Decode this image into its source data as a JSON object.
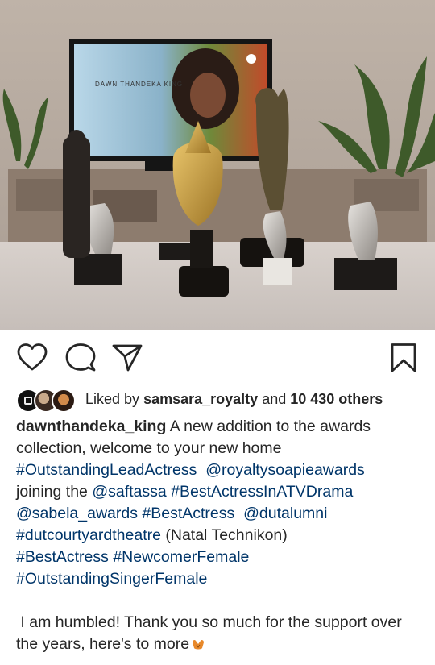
{
  "photo": {
    "tv_overlay_text": "DAWN THANDEKA KING",
    "alt": "awards trophies in front of television"
  },
  "actions": {
    "like_icon": "heart-icon",
    "comment_icon": "comment-icon",
    "share_icon": "send-icon",
    "save_icon": "bookmark-icon"
  },
  "likes": {
    "prefix": "Liked by",
    "user": "samsara_royalty",
    "and": "and",
    "others": "10 430 others"
  },
  "caption": {
    "username": "dawnthandeka_king",
    "line1_rest": " A new addition to the awards collection, welcome to your new home",
    "tag_lead": "#OutstandingLeadActress",
    "mention_royalty": "@royaltysoapieawards",
    "joining": "joining the",
    "mention_saftassa": "@saftassa",
    "tag_best_tv": "#BestActressInATVDrama",
    "mention_sabela": "@sabela_awards",
    "tag_best1": "#BestActress",
    "mention_dut": "@dutalumni",
    "tag_dut": "#dutcourtyardtheatre",
    "natal": "(Natal Technikon)",
    "tag_best2": "#BestActress",
    "tag_newcomer": "#NewcomerFemale",
    "tag_singer": "#OutstandingSingerFemale",
    "closing": "I am humbled! Thank you so much for the support over the years, here's to more"
  },
  "colors": {
    "hashtag": "#003569",
    "text": "#262626"
  }
}
